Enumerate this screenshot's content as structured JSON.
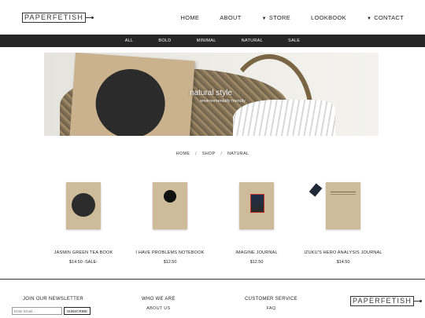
{
  "header": {
    "logo": "PAPERFETISH",
    "nav": [
      {
        "label": "HOME",
        "dropdown": false
      },
      {
        "label": "ABOUT",
        "dropdown": false
      },
      {
        "label": "STORE",
        "dropdown": true
      },
      {
        "label": "LOOKBOOK",
        "dropdown": false
      },
      {
        "label": "CONTACT",
        "dropdown": true
      }
    ]
  },
  "subnav": [
    "ALL",
    "BOLD",
    "MINIMAL",
    "NATURAL",
    "SALE"
  ],
  "hero": {
    "title": "natural style",
    "subtitle": "environmentally friendly"
  },
  "breadcrumb": [
    "HOME",
    "SHOP",
    "NATURAL"
  ],
  "products": [
    {
      "name": "JASMIN GREEN TEA BOOK",
      "price": "$14.50 -SALE-"
    },
    {
      "name": "I HAVE PROBLEMS NOTEBOOK",
      "price": "$12.50"
    },
    {
      "name": "IMAGINE JOURNAL",
      "price": "$12.50"
    },
    {
      "name": "IZUKU'S HERO ANALYSIS JOURNAL",
      "price": "$14.50"
    }
  ],
  "footer": {
    "newsletter_title": "JOIN OUR NEWSLETTER",
    "email_placeholder": "Enter Email...",
    "subscribe_label": "SUBSCRIBE",
    "who_we_are": {
      "title": "WHO WE ARE",
      "links": [
        "ABOUT US"
      ]
    },
    "customer_service": {
      "title": "CUSTOMER SERVICE",
      "links": [
        "FAQ"
      ]
    },
    "logo": "PAPERFETISH"
  },
  "colors": {
    "subnav_bg": "#262626",
    "text": "#222222",
    "kraft": "#cdbb9a"
  }
}
